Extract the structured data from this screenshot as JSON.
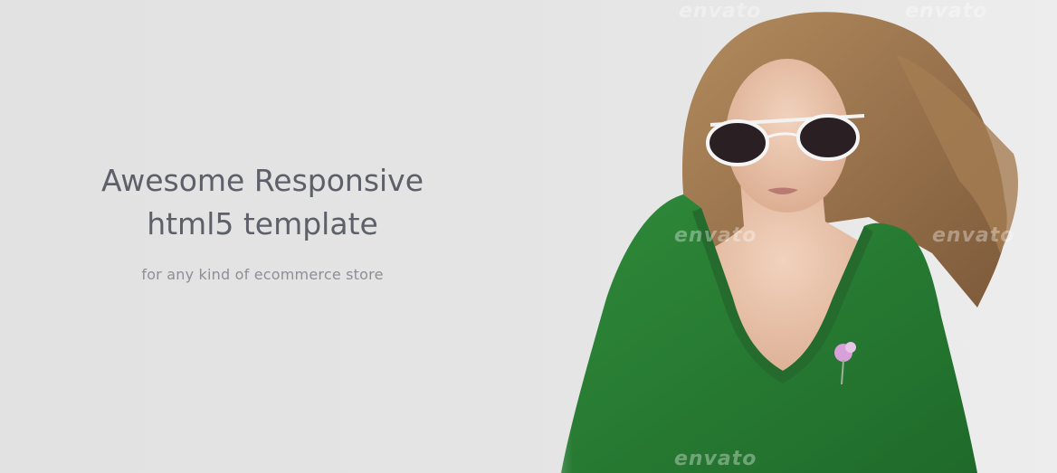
{
  "hero": {
    "headline_line1": "Awesome Responsive",
    "headline_line2": "html5 template",
    "subline": "for any kind of ecommerce store"
  },
  "watermark": {
    "text": "envato"
  },
  "colors": {
    "background": "#e4e4e4",
    "headline": "#5d6068",
    "subline": "#8c8f96",
    "sweater": "#2e7d32",
    "hair": "#9a7550"
  },
  "image": {
    "subject": "model-photo",
    "icon": "woman-in-sunglasses-green-sweater"
  }
}
